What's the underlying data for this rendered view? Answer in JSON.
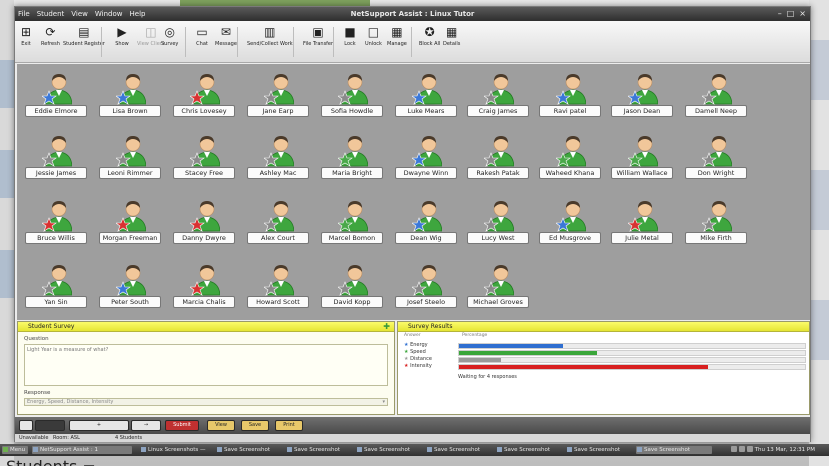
{
  "window": {
    "title": "NetSupport Assist : Linux Tutor",
    "menus": [
      "File",
      "Student",
      "View",
      "Window",
      "Help"
    ],
    "controls": [
      "–",
      "□",
      "×"
    ]
  },
  "toolbar": [
    {
      "label": "Exit",
      "icon": "exit-icon",
      "glyph": "⊞",
      "enabled": true
    },
    {
      "label": "Refresh",
      "icon": "refresh-icon",
      "glyph": "⟳",
      "enabled": true
    },
    {
      "label": "Student Register",
      "icon": "register-icon",
      "glyph": "▤",
      "enabled": true
    },
    {
      "label": "Show",
      "icon": "play-icon",
      "glyph": "▶",
      "enabled": true
    },
    {
      "label": "View Client",
      "icon": "view-icon",
      "glyph": "◫",
      "enabled": false
    },
    {
      "label": "Survey",
      "icon": "survey-icon",
      "glyph": "◎",
      "enabled": true
    },
    {
      "label": "Chat",
      "icon": "chat-icon",
      "glyph": "▭",
      "enabled": true
    },
    {
      "label": "Message",
      "icon": "message-icon",
      "glyph": "✉",
      "enabled": true
    },
    {
      "label": "Send/Collect Work",
      "icon": "send-collect-icon",
      "glyph": "▥",
      "enabled": true
    },
    {
      "label": "File Transfer",
      "icon": "file-transfer-icon",
      "glyph": "▣",
      "enabled": true
    },
    {
      "label": "Lock",
      "icon": "lock-icon",
      "glyph": "■",
      "enabled": true
    },
    {
      "label": "Unlock",
      "icon": "unlock-icon",
      "glyph": "□",
      "enabled": true
    },
    {
      "label": "Manage",
      "icon": "manage-icon",
      "glyph": "▦",
      "enabled": true
    },
    {
      "label": "Block All",
      "icon": "block-all-icon",
      "glyph": "✪",
      "enabled": true
    },
    {
      "label": "Details",
      "icon": "details-icon",
      "glyph": "▦",
      "enabled": true
    }
  ],
  "students": [
    {
      "name": "Eddie Elmore",
      "star": "#3b78d8"
    },
    {
      "name": "Lisa Brown",
      "star": "#3b78d8"
    },
    {
      "name": "Chris Lovesey",
      "star": "#d83232"
    },
    {
      "name": "Jane Earp",
      "star": "#8a8a8a"
    },
    {
      "name": "Sofia Howdle",
      "star": "#8a8a8a"
    },
    {
      "name": "Luke Mears",
      "star": "#3b78d8"
    },
    {
      "name": "Craig James",
      "star": "#8a8a8a"
    },
    {
      "name": "Ravi patel",
      "star": "#3b78d8"
    },
    {
      "name": "Jason Dean",
      "star": "#3b78d8"
    },
    {
      "name": "Damell Neep",
      "star": "#8a8a8a"
    },
    {
      "name": "Jessie James",
      "star": "#8a8a8a"
    },
    {
      "name": "Leoni Rimmer",
      "star": "#8a8a8a"
    },
    {
      "name": "Stacey Free",
      "star": "#8a8a8a"
    },
    {
      "name": "Ashley Mac",
      "star": "#8a8a8a"
    },
    {
      "name": "Maria Bright",
      "star": "#4aa84a"
    },
    {
      "name": "Dwayne Winn",
      "star": "#3b78d8"
    },
    {
      "name": "Rakesh Patak",
      "star": "#8a8a8a"
    },
    {
      "name": "Waheed Khana",
      "star": "#4aa84a"
    },
    {
      "name": "William Wallace",
      "star": "#4aa84a"
    },
    {
      "name": "Don Wright",
      "star": "#8a8a8a"
    },
    {
      "name": "Bruce Willis",
      "star": "#d83232"
    },
    {
      "name": "Morgan Freeman",
      "star": "#d83232"
    },
    {
      "name": "Danny Dwyre",
      "star": "#d83232"
    },
    {
      "name": "Alex Court",
      "star": "#8a8a8a"
    },
    {
      "name": "Marcel Bomon",
      "star": "#4aa84a"
    },
    {
      "name": "Dean Wig",
      "star": "#3b78d8"
    },
    {
      "name": "Lucy West",
      "star": "#8a8a8a"
    },
    {
      "name": "Ed Musgrove",
      "star": "#3b78d8"
    },
    {
      "name": "Julie Metal",
      "star": "#d83232"
    },
    {
      "name": "Mike Firth",
      "star": "#8a8a8a"
    },
    {
      "name": "Yan Sin",
      "star": "#8a8a8a"
    },
    {
      "name": "Peter South",
      "star": "#3b78d8"
    },
    {
      "name": "Marcia Chalis",
      "star": "#d83232"
    },
    {
      "name": "Howard Scott",
      "star": "#8a8a8a"
    },
    {
      "name": "David Kopp",
      "star": "#8a8a8a"
    },
    {
      "name": "Josef Steelo",
      "star": "#8a8a8a"
    },
    {
      "name": "Michael Groves",
      "star": "#8a8a8a"
    }
  ],
  "survey": {
    "title": "Student Survey",
    "question_label": "Question",
    "question_text": "Light Year is a measure of what?",
    "response_label": "Response",
    "response_value": "Energy, Speed, Distance, Intensity"
  },
  "results": {
    "title": "Survey Results",
    "col_answer": "Answer",
    "col_percentage": "Percentage",
    "rows": [
      {
        "label": "Energy",
        "color": "#2f6fd0",
        "pct": 30
      },
      {
        "label": "Speed",
        "color": "#3aa63a",
        "pct": 40
      },
      {
        "label": "Distance",
        "color": "#9a9a9a",
        "pct": 12
      },
      {
        "label": "Intensity",
        "color": "#d82020",
        "pct": 72
      }
    ],
    "status": "Waiting for 4 responses"
  },
  "bottombar": [
    {
      "label": "",
      "style": "",
      "name": "bottom-btn-1"
    },
    {
      "label": "",
      "style": "dark",
      "name": "bottom-btn-2"
    },
    {
      "label": "+",
      "style": "",
      "name": "bottom-add-button"
    },
    {
      "label": "→",
      "style": "",
      "name": "bottom-forward-button"
    },
    {
      "label": "Submit",
      "style": "red",
      "name": "bottom-submit-button"
    },
    {
      "label": "View",
      "style": "gold",
      "name": "bottom-view-button"
    },
    {
      "label": "Save",
      "style": "gold",
      "name": "bottom-save-button"
    },
    {
      "label": "Print",
      "style": "gold",
      "name": "bottom-print-button"
    }
  ],
  "statusbar": {
    "left": "Unavailable",
    "room": "Room: ASL",
    "students": "4 Students"
  },
  "taskbar": {
    "items": [
      "Menu",
      "NetSupport Assist : 1",
      "Linux Screenshots — ",
      "Save Screenshot",
      "Save Screenshot",
      "Save Screenshot",
      "Save Screenshot",
      "Save Screenshot",
      "Save Screenshot",
      "Save Screenshot"
    ],
    "clock": "Thu 13 Mar, 12:31 PM"
  },
  "caption": "Students ⌐"
}
